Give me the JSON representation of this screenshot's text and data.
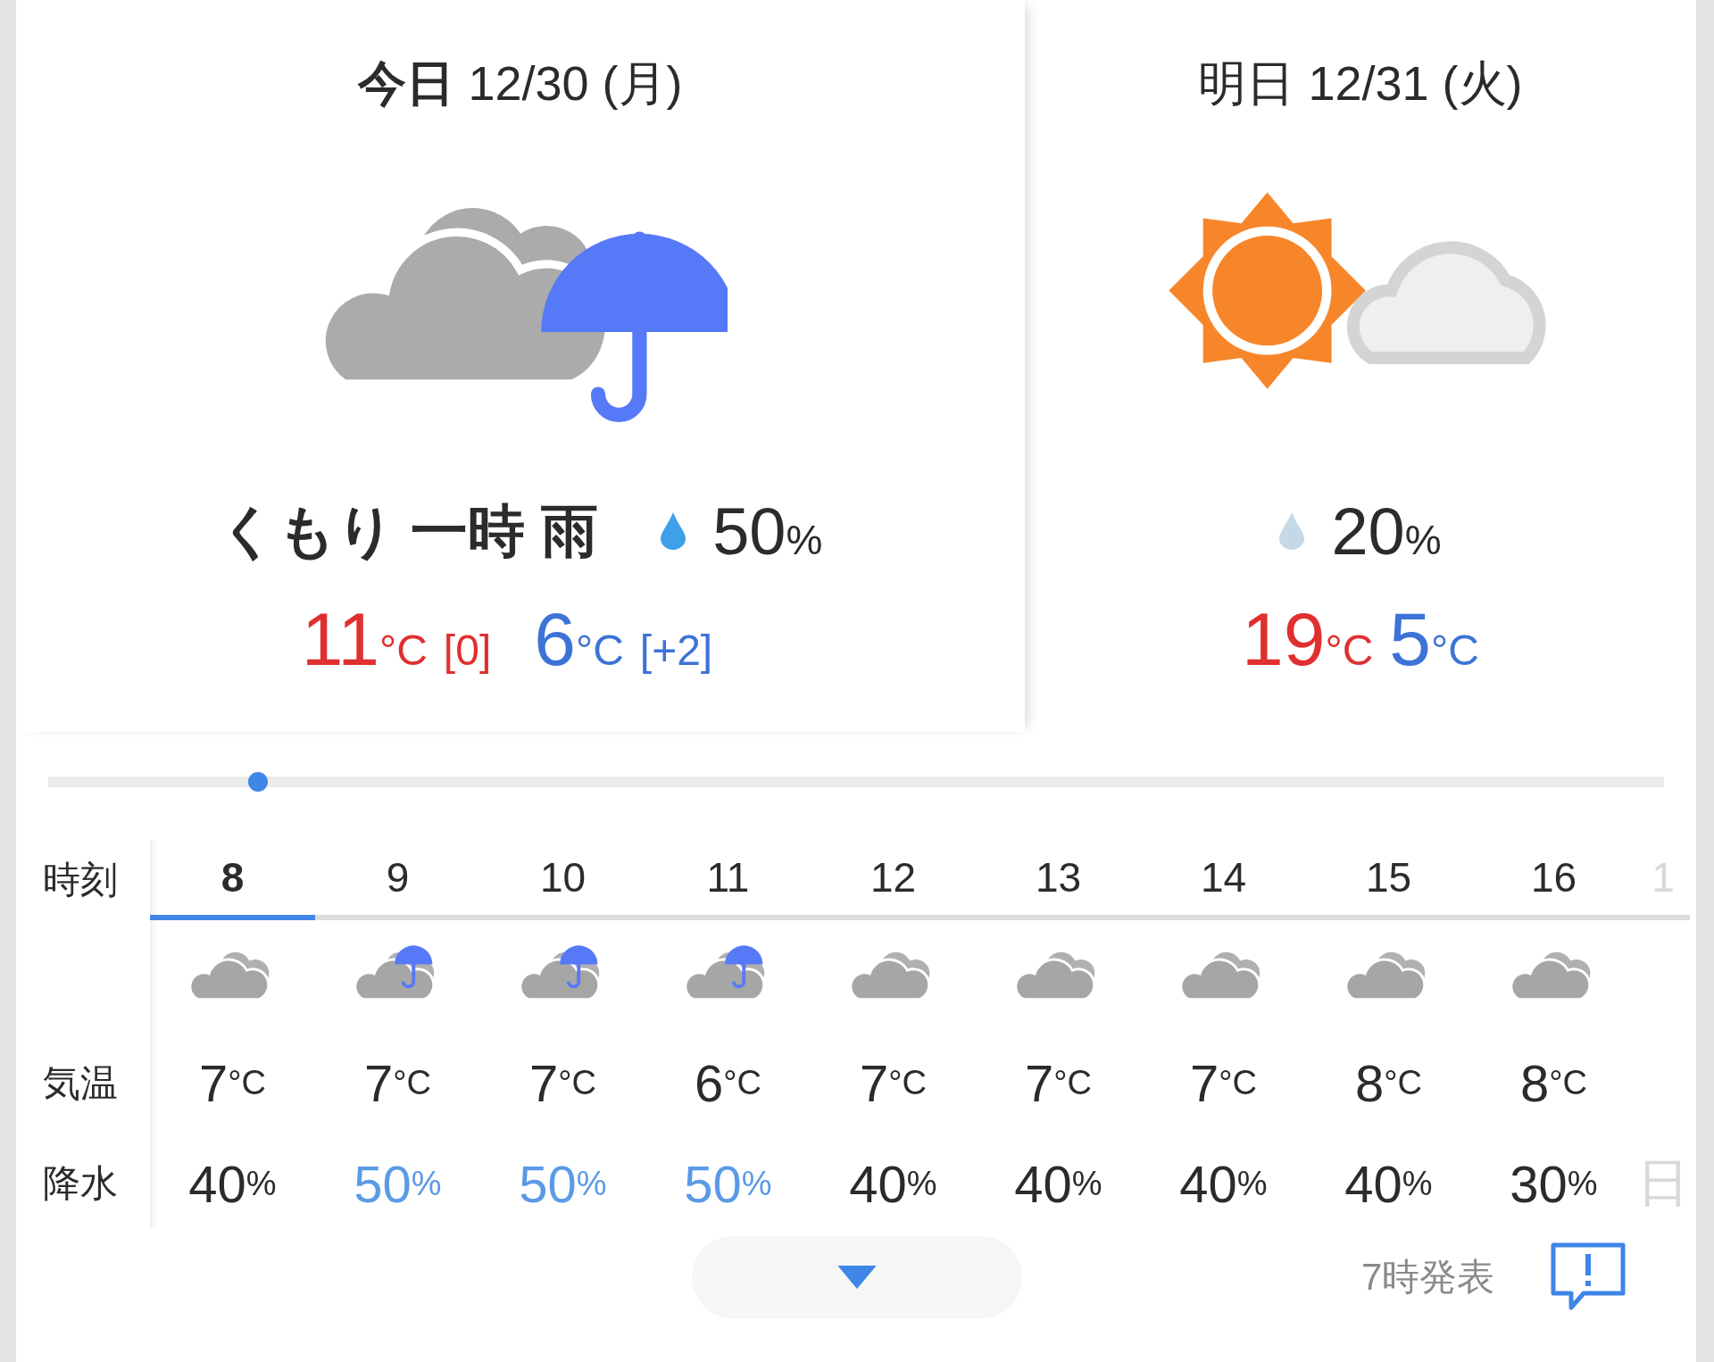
{
  "days": [
    {
      "title": "**今日** 12/30 (月)",
      "selected": true,
      "kind": "cloudy_rain",
      "condition": "くもり 一時 雨",
      "precip": "50",
      "precip_unit": "%",
      "color": "#3ea0e6",
      "high": "11",
      "high_unit": "°C",
      "high_diff": "[0]",
      "low": "6",
      "low_unit": "°C",
      "low_diff": "[+2]"
    },
    {
      "title": "明日 12/31 (火)",
      "selected": false,
      "kind": "sunny_cloudy",
      "precip": "20",
      "precip_unit": "%",
      "color": "#c5d8e6",
      "high": "19",
      "high_unit": "°C",
      "low": "5",
      "low_unit": "°C"
    }
  ],
  "time_slider": {
    "level": 0.13
  },
  "hourly": {
    "row_labels": {
      "time": "時刻",
      "temp": "気温",
      "precip": "降水"
    },
    "hours": [
      {
        "hour": "8",
        "selected": true,
        "kind": "cloudy",
        "temp": "7",
        "temp_unit": "°C",
        "precip": "40",
        "precip_unit": "%",
        "rainy": false
      },
      {
        "hour": "9",
        "selected": false,
        "kind": "cloudy_rain",
        "temp": "7",
        "temp_unit": "°C",
        "precip": "50",
        "precip_unit": "%",
        "rainy": true
      },
      {
        "hour": "10",
        "selected": false,
        "kind": "cloudy_rain",
        "temp": "7",
        "temp_unit": "°C",
        "precip": "50",
        "precip_unit": "%",
        "rainy": true
      },
      {
        "hour": "11",
        "selected": false,
        "kind": "cloudy_rain",
        "temp": "6",
        "temp_unit": "°C",
        "precip": "50",
        "precip_unit": "%",
        "rainy": true
      },
      {
        "hour": "12",
        "selected": false,
        "kind": "cloudy",
        "temp": "7",
        "temp_unit": "°C",
        "precip": "40",
        "precip_unit": "%",
        "rainy": false
      },
      {
        "hour": "13",
        "selected": false,
        "kind": "cloudy",
        "temp": "7",
        "temp_unit": "°C",
        "precip": "40",
        "precip_unit": "%",
        "rainy": false
      },
      {
        "hour": "14",
        "selected": false,
        "kind": "cloudy",
        "temp": "7",
        "temp_unit": "°C",
        "precip": "40",
        "precip_unit": "%",
        "rainy": false
      },
      {
        "hour": "15",
        "selected": false,
        "kind": "cloudy",
        "temp": "8",
        "temp_unit": "°C",
        "precip": "40",
        "precip_unit": "%",
        "rainy": false
      },
      {
        "hour": "16",
        "selected": false,
        "kind": "cloudy",
        "temp": "8",
        "temp_unit": "°C",
        "precip": "30",
        "precip_unit": "%",
        "rainy": false
      }
    ],
    "cut_column": {
      "hour": "1",
      "precip": "日"
    }
  },
  "footer": {
    "issued": "7時発表"
  }
}
